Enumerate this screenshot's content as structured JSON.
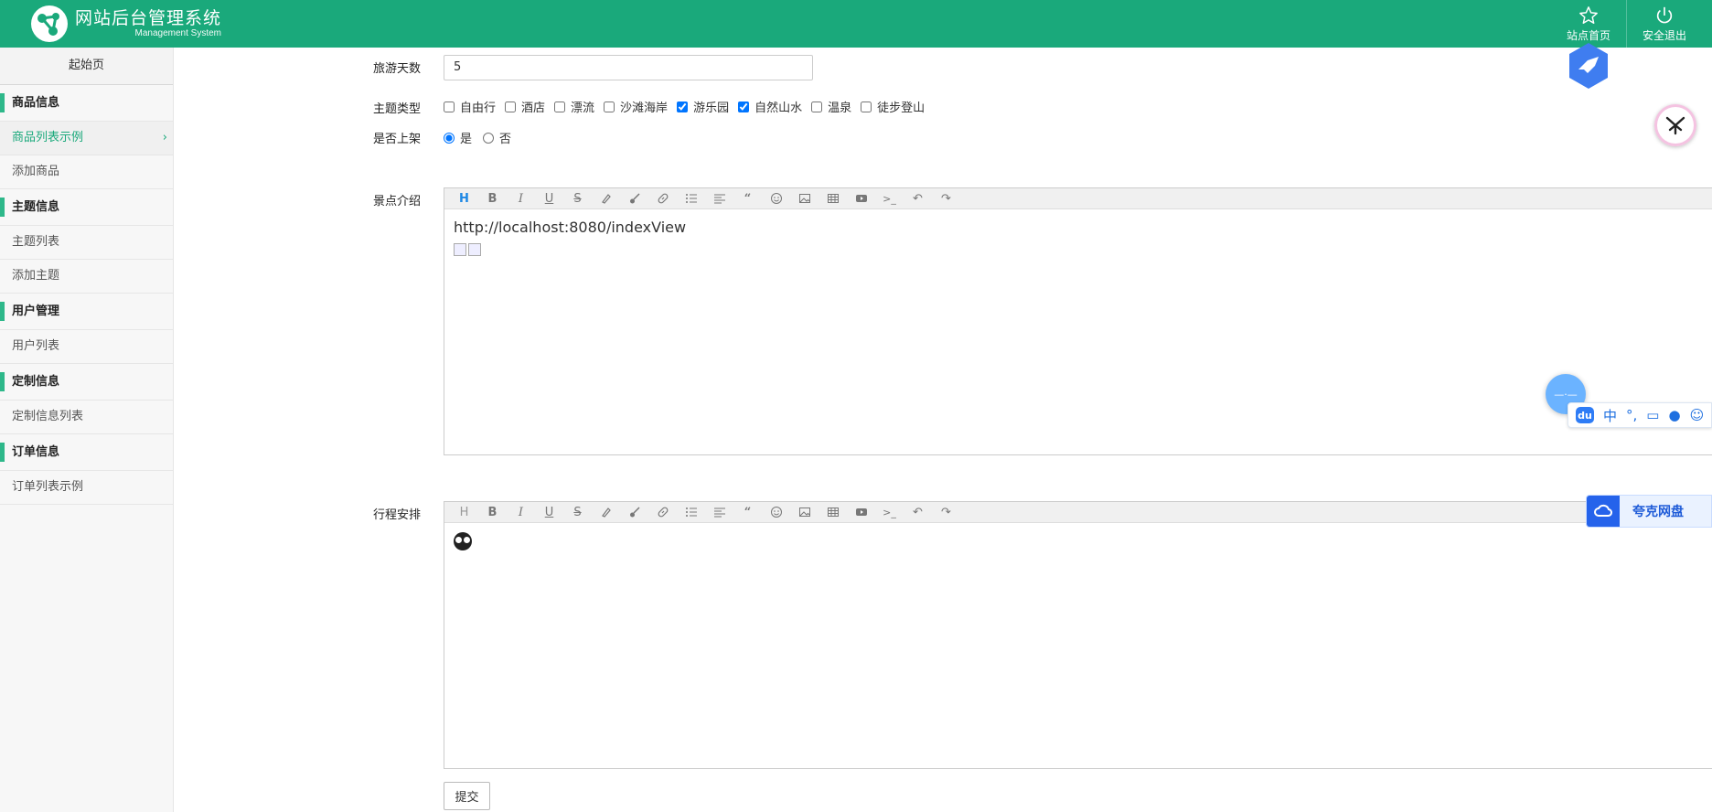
{
  "header": {
    "brand_title": "网站后台管理系统",
    "brand_subtitle": "Management System",
    "home_label": "站点首页",
    "logout_label": "安全退出"
  },
  "sidebar": {
    "start_label": "起始页",
    "groups": [
      {
        "title": "商品信息",
        "items": [
          {
            "label": "商品列表示例",
            "active": true
          },
          {
            "label": "添加商品"
          }
        ]
      },
      {
        "title": "主题信息",
        "items": [
          {
            "label": "主题列表"
          },
          {
            "label": "添加主题"
          }
        ]
      },
      {
        "title": "用户管理",
        "items": [
          {
            "label": "用户列表"
          }
        ]
      },
      {
        "title": "定制信息",
        "items": [
          {
            "label": "定制信息列表"
          }
        ]
      },
      {
        "title": "订单信息",
        "items": [
          {
            "label": "订单列表示例"
          }
        ]
      }
    ]
  },
  "form": {
    "days_label": "旅游天数",
    "days_value": "5",
    "theme_label": "主题类型",
    "themes": [
      {
        "label": "自由行",
        "checked": false
      },
      {
        "label": "酒店",
        "checked": false
      },
      {
        "label": "漂流",
        "checked": false
      },
      {
        "label": "沙滩海岸",
        "checked": false
      },
      {
        "label": "游乐园",
        "checked": true
      },
      {
        "label": "自然山水",
        "checked": true
      },
      {
        "label": "温泉",
        "checked": false
      },
      {
        "label": "徒步登山",
        "checked": false
      }
    ],
    "onsale_label": "是否上架",
    "onsale_options": [
      {
        "label": "是",
        "checked": true
      },
      {
        "label": "否",
        "checked": false
      }
    ],
    "intro_label": "景点介绍",
    "intro_content": "http://localhost:8080/indexView",
    "schedule_label": "行程安排",
    "submit_label": "提交"
  },
  "overlays": {
    "ime_chars": [
      "中",
      "°,"
    ],
    "ime_du": "du",
    "quark_label": "夸克网盘"
  },
  "colors": {
    "header": "#1aa97b",
    "accent": "#2eb88a",
    "link": "#1e88e5"
  }
}
